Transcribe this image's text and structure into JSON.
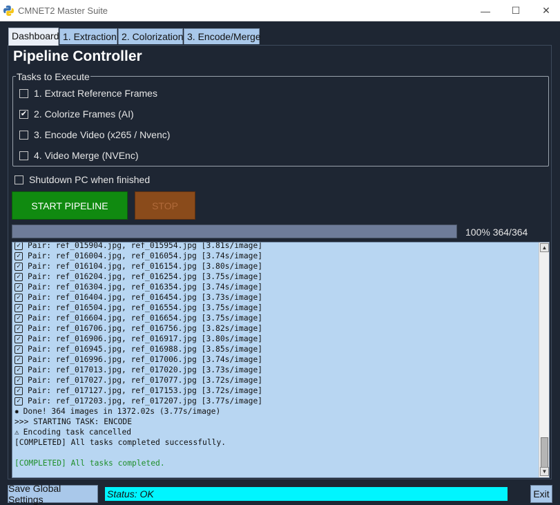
{
  "window": {
    "title": "CMNET2 Master Suite",
    "icon": "python-icon",
    "controls": {
      "minimize": "—",
      "maximize": "☐",
      "close": "✕"
    }
  },
  "tabs": [
    {
      "label": "Dashboard",
      "active": true
    },
    {
      "label": "1. Extraction",
      "active": false
    },
    {
      "label": "2. Colorization",
      "active": false
    },
    {
      "label": "3. Encode/Merge",
      "active": false
    }
  ],
  "page": {
    "title": "Pipeline Controller"
  },
  "tasks": {
    "legend": "Tasks to Execute",
    "items": [
      {
        "label": "1. Extract Reference Frames",
        "checked": false
      },
      {
        "label": "2. Colorize Frames (AI)",
        "checked": true
      },
      {
        "label": "3. Encode Video (x265 / Nvenc)",
        "checked": false
      },
      {
        "label": "4. Video Merge (NVEnc)",
        "checked": false
      }
    ]
  },
  "shutdown": {
    "label": "Shutdown PC when finished",
    "checked": false
  },
  "buttons": {
    "start": "START PIPELINE",
    "stop": "STOP"
  },
  "progress": {
    "fraction": 1.0,
    "text": "100% 364/364"
  },
  "log": {
    "lines": [
      {
        "type": "check",
        "text": "Pair: ref_015904.jpg, ref_015954.jpg [3.81s/image]"
      },
      {
        "type": "check",
        "text": "Pair: ref_016004.jpg, ref_016054.jpg [3.74s/image]"
      },
      {
        "type": "check",
        "text": "Pair: ref_016104.jpg, ref_016154.jpg [3.80s/image]"
      },
      {
        "type": "check",
        "text": "Pair: ref_016204.jpg, ref_016254.jpg [3.75s/image]"
      },
      {
        "type": "check",
        "text": "Pair: ref_016304.jpg, ref_016354.jpg [3.74s/image]"
      },
      {
        "type": "check",
        "text": "Pair: ref_016404.jpg, ref_016454.jpg [3.73s/image]"
      },
      {
        "type": "check",
        "text": "Pair: ref_016504.jpg, ref_016554.jpg [3.75s/image]"
      },
      {
        "type": "check",
        "text": "Pair: ref_016604.jpg, ref_016654.jpg [3.75s/image]"
      },
      {
        "type": "check",
        "text": "Pair: ref_016706.jpg, ref_016756.jpg [3.82s/image]"
      },
      {
        "type": "check",
        "text": "Pair: ref_016906.jpg, ref_016917.jpg [3.80s/image]"
      },
      {
        "type": "check",
        "text": "Pair: ref_016945.jpg, ref_016988.jpg [3.85s/image]"
      },
      {
        "type": "check",
        "text": "Pair: ref_016996.jpg, ref_017006.jpg [3.74s/image]"
      },
      {
        "type": "check",
        "text": "Pair: ref_017013.jpg, ref_017020.jpg [3.73s/image]"
      },
      {
        "type": "check",
        "text": "Pair: ref_017027.jpg, ref_017077.jpg [3.72s/image]"
      },
      {
        "type": "check",
        "text": "Pair: ref_017127.jpg, ref_017153.jpg [3.72s/image]"
      },
      {
        "type": "check",
        "text": "Pair: ref_017203.jpg, ref_017207.jpg [3.77s/image]"
      },
      {
        "type": "done",
        "text": "Done! 364 images in 1372.02s (3.77s/image)"
      },
      {
        "type": "plain",
        "text": ">>> STARTING TASK: ENCODE"
      },
      {
        "type": "warn",
        "text": "Encoding task cancelled"
      },
      {
        "type": "plain",
        "text": "[COMPLETED] All tasks completed successfully."
      },
      {
        "type": "blank",
        "text": ""
      },
      {
        "type": "green",
        "text": "[COMPLETED] All tasks completed."
      }
    ]
  },
  "footer": {
    "save_label": "Save Global Settings",
    "status": "Status: OK",
    "exit_label": "Exit"
  },
  "colors": {
    "background": "#1e2633",
    "tab": "#a9c8ea",
    "start": "#108a10",
    "stop": "#8a4b1b",
    "log_bg": "#b8d6f2",
    "status_bg": "#00f5ff",
    "success_text": "#1f8f2a"
  }
}
